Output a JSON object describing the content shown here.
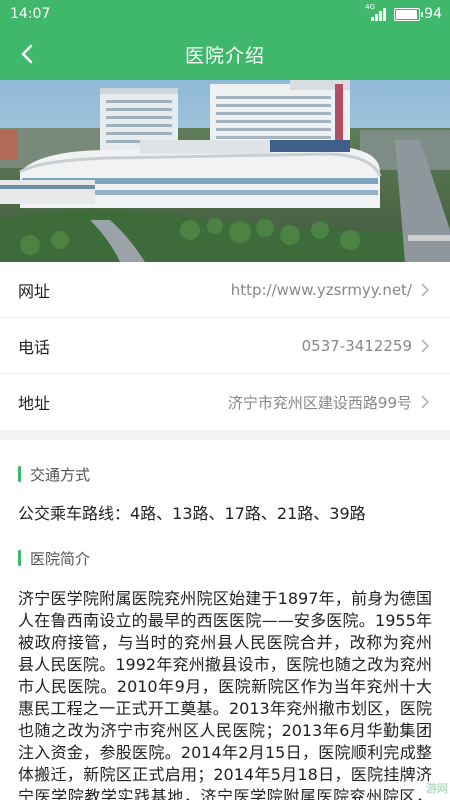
{
  "status_bar": {
    "time": "14:07",
    "network": "4G",
    "battery_level": "94",
    "battery_fraction": 0.94
  },
  "nav": {
    "title": "医院介绍",
    "back_icon": "chevron-left-icon"
  },
  "hero": {
    "image": "hospital-aerial-photo"
  },
  "info_rows": [
    {
      "label": "网址",
      "value": "http://www.yzsrmyy.net/"
    },
    {
      "label": "电话",
      "value": "0537-3412259"
    },
    {
      "label": "地址",
      "value": "济宁市兖州区建设西路99号"
    }
  ],
  "transit": {
    "heading": "交通方式",
    "text": "公交乘车路线：4路、13路、17路、21路、39路"
  },
  "intro": {
    "heading": "医院简介",
    "text": "济宁医学院附属医院兖州院区始建于1897年，前身为德国人在鲁西南设立的最早的西医医院——安多医院。1955年被政府接管，与当时的兖州县人民医院合并，改称为兖州县人民医院。1992年兖州撤县设市，医院也随之改为兖州市人民医院。2010年9月，医院新院区作为当年兖州十大惠民工程之一正式开工奠基。2013年兖州撤市划区，医院也随之改为济宁市兖州区人民医院；2013年6月华勤集团注入资金，参股医院。2014年2月15日，医院顺利完成整体搬迁，新院区正式启用；2014年5月18日，医院挂牌济宁医学院教学实践基地，济宁医学院附属医院兖州院区，由济"
  },
  "watermark": "游网",
  "colors": {
    "accent": "#3fb86b",
    "text": "#222222",
    "muted": "#888888"
  }
}
